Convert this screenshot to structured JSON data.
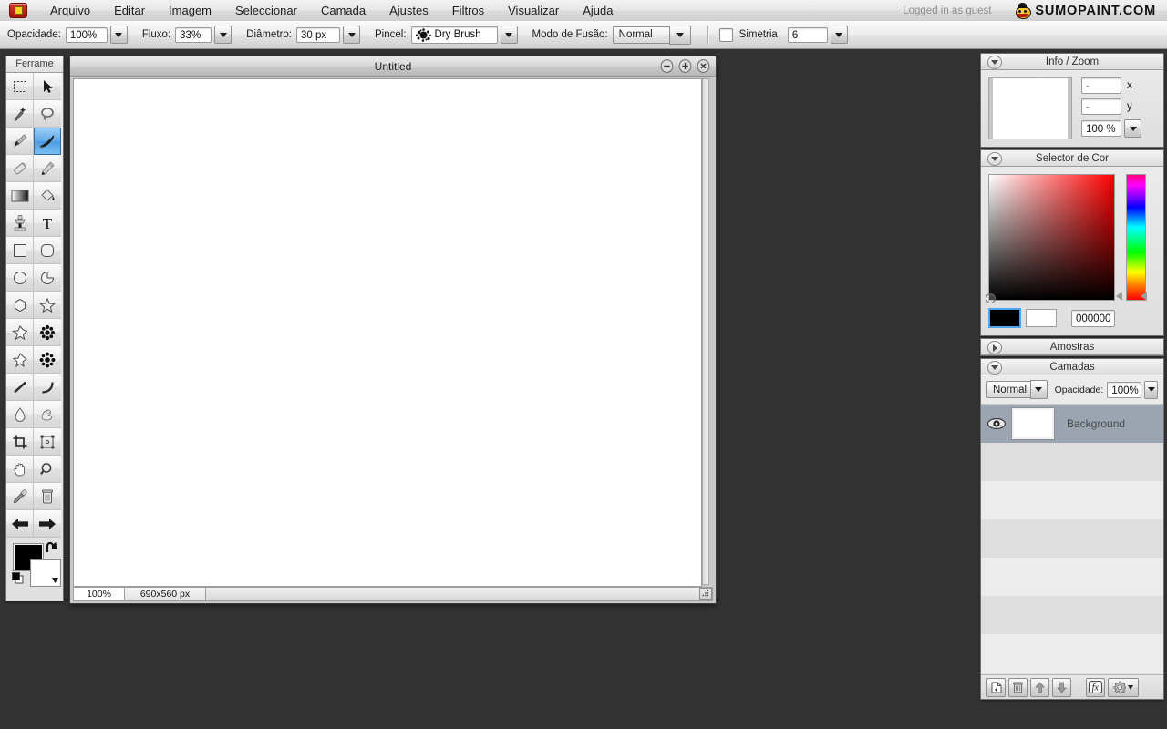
{
  "app": {
    "brand": "SUMOPAINT.COM",
    "login_status": "Logged in as guest",
    "logo_icon": "sumo-logo-icon"
  },
  "menubar": {
    "items": [
      {
        "label": "Arquivo",
        "name": "menu-arquivo"
      },
      {
        "label": "Editar",
        "name": "menu-editar"
      },
      {
        "label": "Imagem",
        "name": "menu-imagem"
      },
      {
        "label": "Seleccionar",
        "name": "menu-seleccionar"
      },
      {
        "label": "Camada",
        "name": "menu-camada"
      },
      {
        "label": "Ajustes",
        "name": "menu-ajustes"
      },
      {
        "label": "Filtros",
        "name": "menu-filtros"
      },
      {
        "label": "Visualizar",
        "name": "menu-visualizar"
      },
      {
        "label": "Ajuda",
        "name": "menu-ajuda"
      }
    ]
  },
  "options_bar": {
    "opacity_label": "Opacidade:",
    "opacity_value": "100%",
    "flow_label": "Fluxo:",
    "flow_value": "33%",
    "diameter_label": "Diâmetro:",
    "diameter_value": "30 px",
    "brush_label": "Pincel:",
    "brush_value": "Dry Brush",
    "blend_label": "Modo de Fusão:",
    "blend_value": "Normal",
    "symmetry_label": "Simetria",
    "symmetry_checked": false,
    "symmetry_value": "6"
  },
  "tools": {
    "title": "Ferrame",
    "selected_index": 5,
    "items": [
      {
        "label": "Marquee",
        "icon": "marquee-select-icon"
      },
      {
        "label": "Move",
        "icon": "move-arrow-icon"
      },
      {
        "label": "Magic Wand",
        "icon": "magic-wand-icon"
      },
      {
        "label": "Lasso",
        "icon": "lasso-icon"
      },
      {
        "label": "Paint Brush",
        "icon": "paintbrush-icon"
      },
      {
        "label": "Brush",
        "icon": "brush-icon"
      },
      {
        "label": "Eraser",
        "icon": "eraser-icon"
      },
      {
        "label": "Pencil",
        "icon": "pencil-icon"
      },
      {
        "label": "Gradient",
        "icon": "gradient-icon"
      },
      {
        "label": "Paint Bucket",
        "icon": "paint-bucket-icon"
      },
      {
        "label": "Clone Stamp",
        "icon": "clone-stamp-icon"
      },
      {
        "label": "Text",
        "icon": "text-icon"
      },
      {
        "label": "Rectangle",
        "icon": "rectangle-icon"
      },
      {
        "label": "Rounded Rectangle",
        "icon": "rounded-rectangle-icon"
      },
      {
        "label": "Ellipse",
        "icon": "ellipse-icon"
      },
      {
        "label": "Pie",
        "icon": "pie-shape-icon"
      },
      {
        "label": "Polygon",
        "icon": "polygon-icon"
      },
      {
        "label": "Star",
        "icon": "star-icon"
      },
      {
        "label": "Star Outline",
        "icon": "star-outline-icon"
      },
      {
        "label": "Flower",
        "icon": "flower-burst-icon"
      },
      {
        "label": "Shard",
        "icon": "shard-icon"
      },
      {
        "label": "Snowflake",
        "icon": "snowflake-icon"
      },
      {
        "label": "Line",
        "icon": "line-icon"
      },
      {
        "label": "Curve",
        "icon": "curve-icon"
      },
      {
        "label": "Blur Drop",
        "icon": "water-drop-icon"
      },
      {
        "label": "Smudge",
        "icon": "smudge-hand-icon"
      },
      {
        "label": "Crop",
        "icon": "crop-icon"
      },
      {
        "label": "Transform",
        "icon": "transform-box-icon"
      },
      {
        "label": "Hand",
        "icon": "hand-icon"
      },
      {
        "label": "Zoom",
        "icon": "magnifier-icon"
      },
      {
        "label": "Eyedropper",
        "icon": "eyedropper-icon"
      },
      {
        "label": "Trash",
        "icon": "trash-icon"
      },
      {
        "label": "Undo",
        "icon": "arrow-left-icon"
      },
      {
        "label": "Redo",
        "icon": "arrow-right-icon"
      }
    ],
    "foreground_color": "#000000",
    "background_color": "#ffffff",
    "swap_icon": "swap-colors-icon",
    "default_icon": "default-colors-icon"
  },
  "canvas_window": {
    "title": "Untitled",
    "minimize_icon": "minimize-icon",
    "maximize_icon": "maximize-icon",
    "close_icon": "close-icon",
    "zoom_status": "100%",
    "size_status": "690x560 px",
    "resize_grip_icon": "resize-grip-icon"
  },
  "panels": {
    "info_zoom": {
      "title": "Info / Zoom",
      "collapse_icon": "triangle-down-icon",
      "expanded": true,
      "x_value": "-",
      "x_label": "x",
      "y_value": "-",
      "y_label": "y",
      "zoom_value": "100 %"
    },
    "color_selector": {
      "title": "Selector de Cor",
      "collapse_icon": "triangle-down-icon",
      "expanded": true,
      "foreground": "#000000",
      "background": "#ffffff",
      "hex_value": "000000",
      "hue": "#ff0000"
    },
    "swatches": {
      "title": "Amostras",
      "collapse_icon": "triangle-right-icon",
      "expanded": false
    },
    "layers": {
      "title": "Camadas",
      "collapse_icon": "triangle-down-icon",
      "expanded": true,
      "blend_mode": "Normal",
      "opacity_label": "Opacidade:",
      "opacity_value": "100%",
      "rows": [
        {
          "name": "Background",
          "visible": true,
          "active": true
        },
        {
          "name": "",
          "visible": false,
          "active": false
        },
        {
          "name": "",
          "visible": false,
          "active": false
        },
        {
          "name": "",
          "visible": false,
          "active": false
        },
        {
          "name": "",
          "visible": false,
          "active": false
        },
        {
          "name": "",
          "visible": false,
          "active": false
        },
        {
          "name": "",
          "visible": false,
          "active": false
        }
      ],
      "footer_buttons": [
        {
          "icon": "new-layer-icon",
          "label": "New Layer"
        },
        {
          "icon": "delete-layer-icon",
          "label": "Delete Layer"
        },
        {
          "icon": "move-layer-up-icon",
          "label": "Move Up"
        },
        {
          "icon": "move-layer-down-icon",
          "label": "Move Down"
        },
        {
          "icon": "layer-effects-fx-icon",
          "label": "Effects"
        },
        {
          "icon": "gear-icon",
          "label": "Settings"
        }
      ]
    }
  },
  "colors": {
    "app_background": "#333333",
    "selection_blue": "#5fa8e8",
    "active_layer": "#9aa5b1"
  }
}
